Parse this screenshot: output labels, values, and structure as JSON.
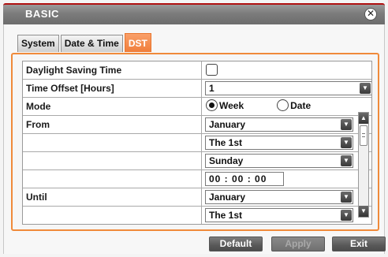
{
  "window": {
    "title": "BASIC"
  },
  "tabs": [
    {
      "label": "System"
    },
    {
      "label": "Date & Time"
    },
    {
      "label": "DST",
      "active": true
    }
  ],
  "form": {
    "dst_label": "Daylight Saving Time",
    "dst_checked": false,
    "offset_label": "Time Offset [Hours]",
    "offset_value": "1",
    "mode_label": "Mode",
    "mode_options": [
      "Week",
      "Date"
    ],
    "mode_selected": "Week",
    "from_label": "From",
    "from_month": "January",
    "from_week": "The 1st",
    "from_day": "Sunday",
    "from_time": "00 : 00 : 00",
    "until_label": "Until",
    "until_month": "January",
    "until_week": "The 1st"
  },
  "buttons": {
    "default": "Default",
    "apply": "Apply",
    "exit": "Exit"
  },
  "colors": {
    "accent": "#f08a3a",
    "title_border": "#b01010"
  }
}
